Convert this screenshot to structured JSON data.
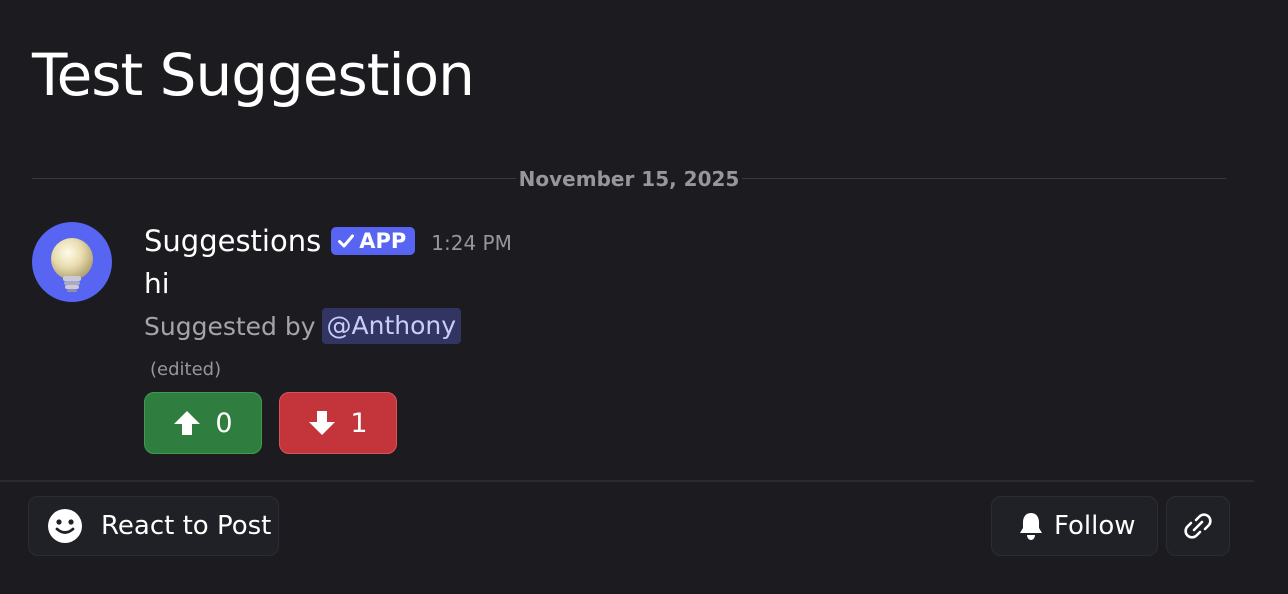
{
  "post": {
    "title": "Test Suggestion"
  },
  "divider": {
    "date": "November 15, 2025"
  },
  "message": {
    "author": "Suggestions",
    "badge": "APP",
    "timestamp": "1:24 PM",
    "text": "hi",
    "suggested_by_label": "Suggested by",
    "mention": "@Anthony",
    "edited": "(edited)",
    "avatar_icon": "lightbulb-icon"
  },
  "votes": {
    "upvote_count": "0",
    "downvote_count": "1",
    "up_icon": "arrow-up-icon",
    "down_icon": "arrow-down-icon"
  },
  "footer": {
    "react_label": "React to Post",
    "follow_label": "Follow",
    "react_icon": "smiley-icon",
    "follow_icon": "bell-icon",
    "link_icon": "link-icon"
  },
  "colors": {
    "background": "#1b1b20",
    "brand": "#5865f2",
    "upvote": "#2f7e3f",
    "downvote": "#c3353b",
    "mention_bg": "#323561",
    "mention_text": "#c9cdfb"
  }
}
